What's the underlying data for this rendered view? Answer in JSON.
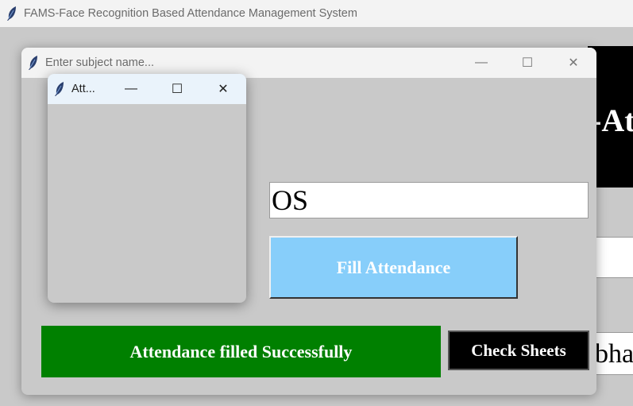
{
  "main_window": {
    "title": "FAMS-Face Recognition Based Attendance Management System"
  },
  "background": {
    "banner_text": "-At",
    "name_field_text": "bha"
  },
  "dialog": {
    "title": "Enter subject name...",
    "subject_input": {
      "value": "OS",
      "placeholder": ""
    },
    "fill_button_label": "Fill Attendance",
    "status_text": "Attendance filled Successfully",
    "check_sheets_label": "Check Sheets",
    "window_controls": {
      "minimize": "—",
      "maximize": "☐",
      "close": "✕"
    }
  },
  "popup": {
    "title": "Att...",
    "window_controls": {
      "minimize": "—",
      "maximize": "☐",
      "close": "✕"
    }
  },
  "colors": {
    "fill_button": "#87cefa",
    "status_banner": "#008000",
    "check_button": "#000000",
    "titlebar": "#f3f3f3",
    "popup_titlebar": "#eaf3fb",
    "window_bg": "#c9c9c9"
  }
}
